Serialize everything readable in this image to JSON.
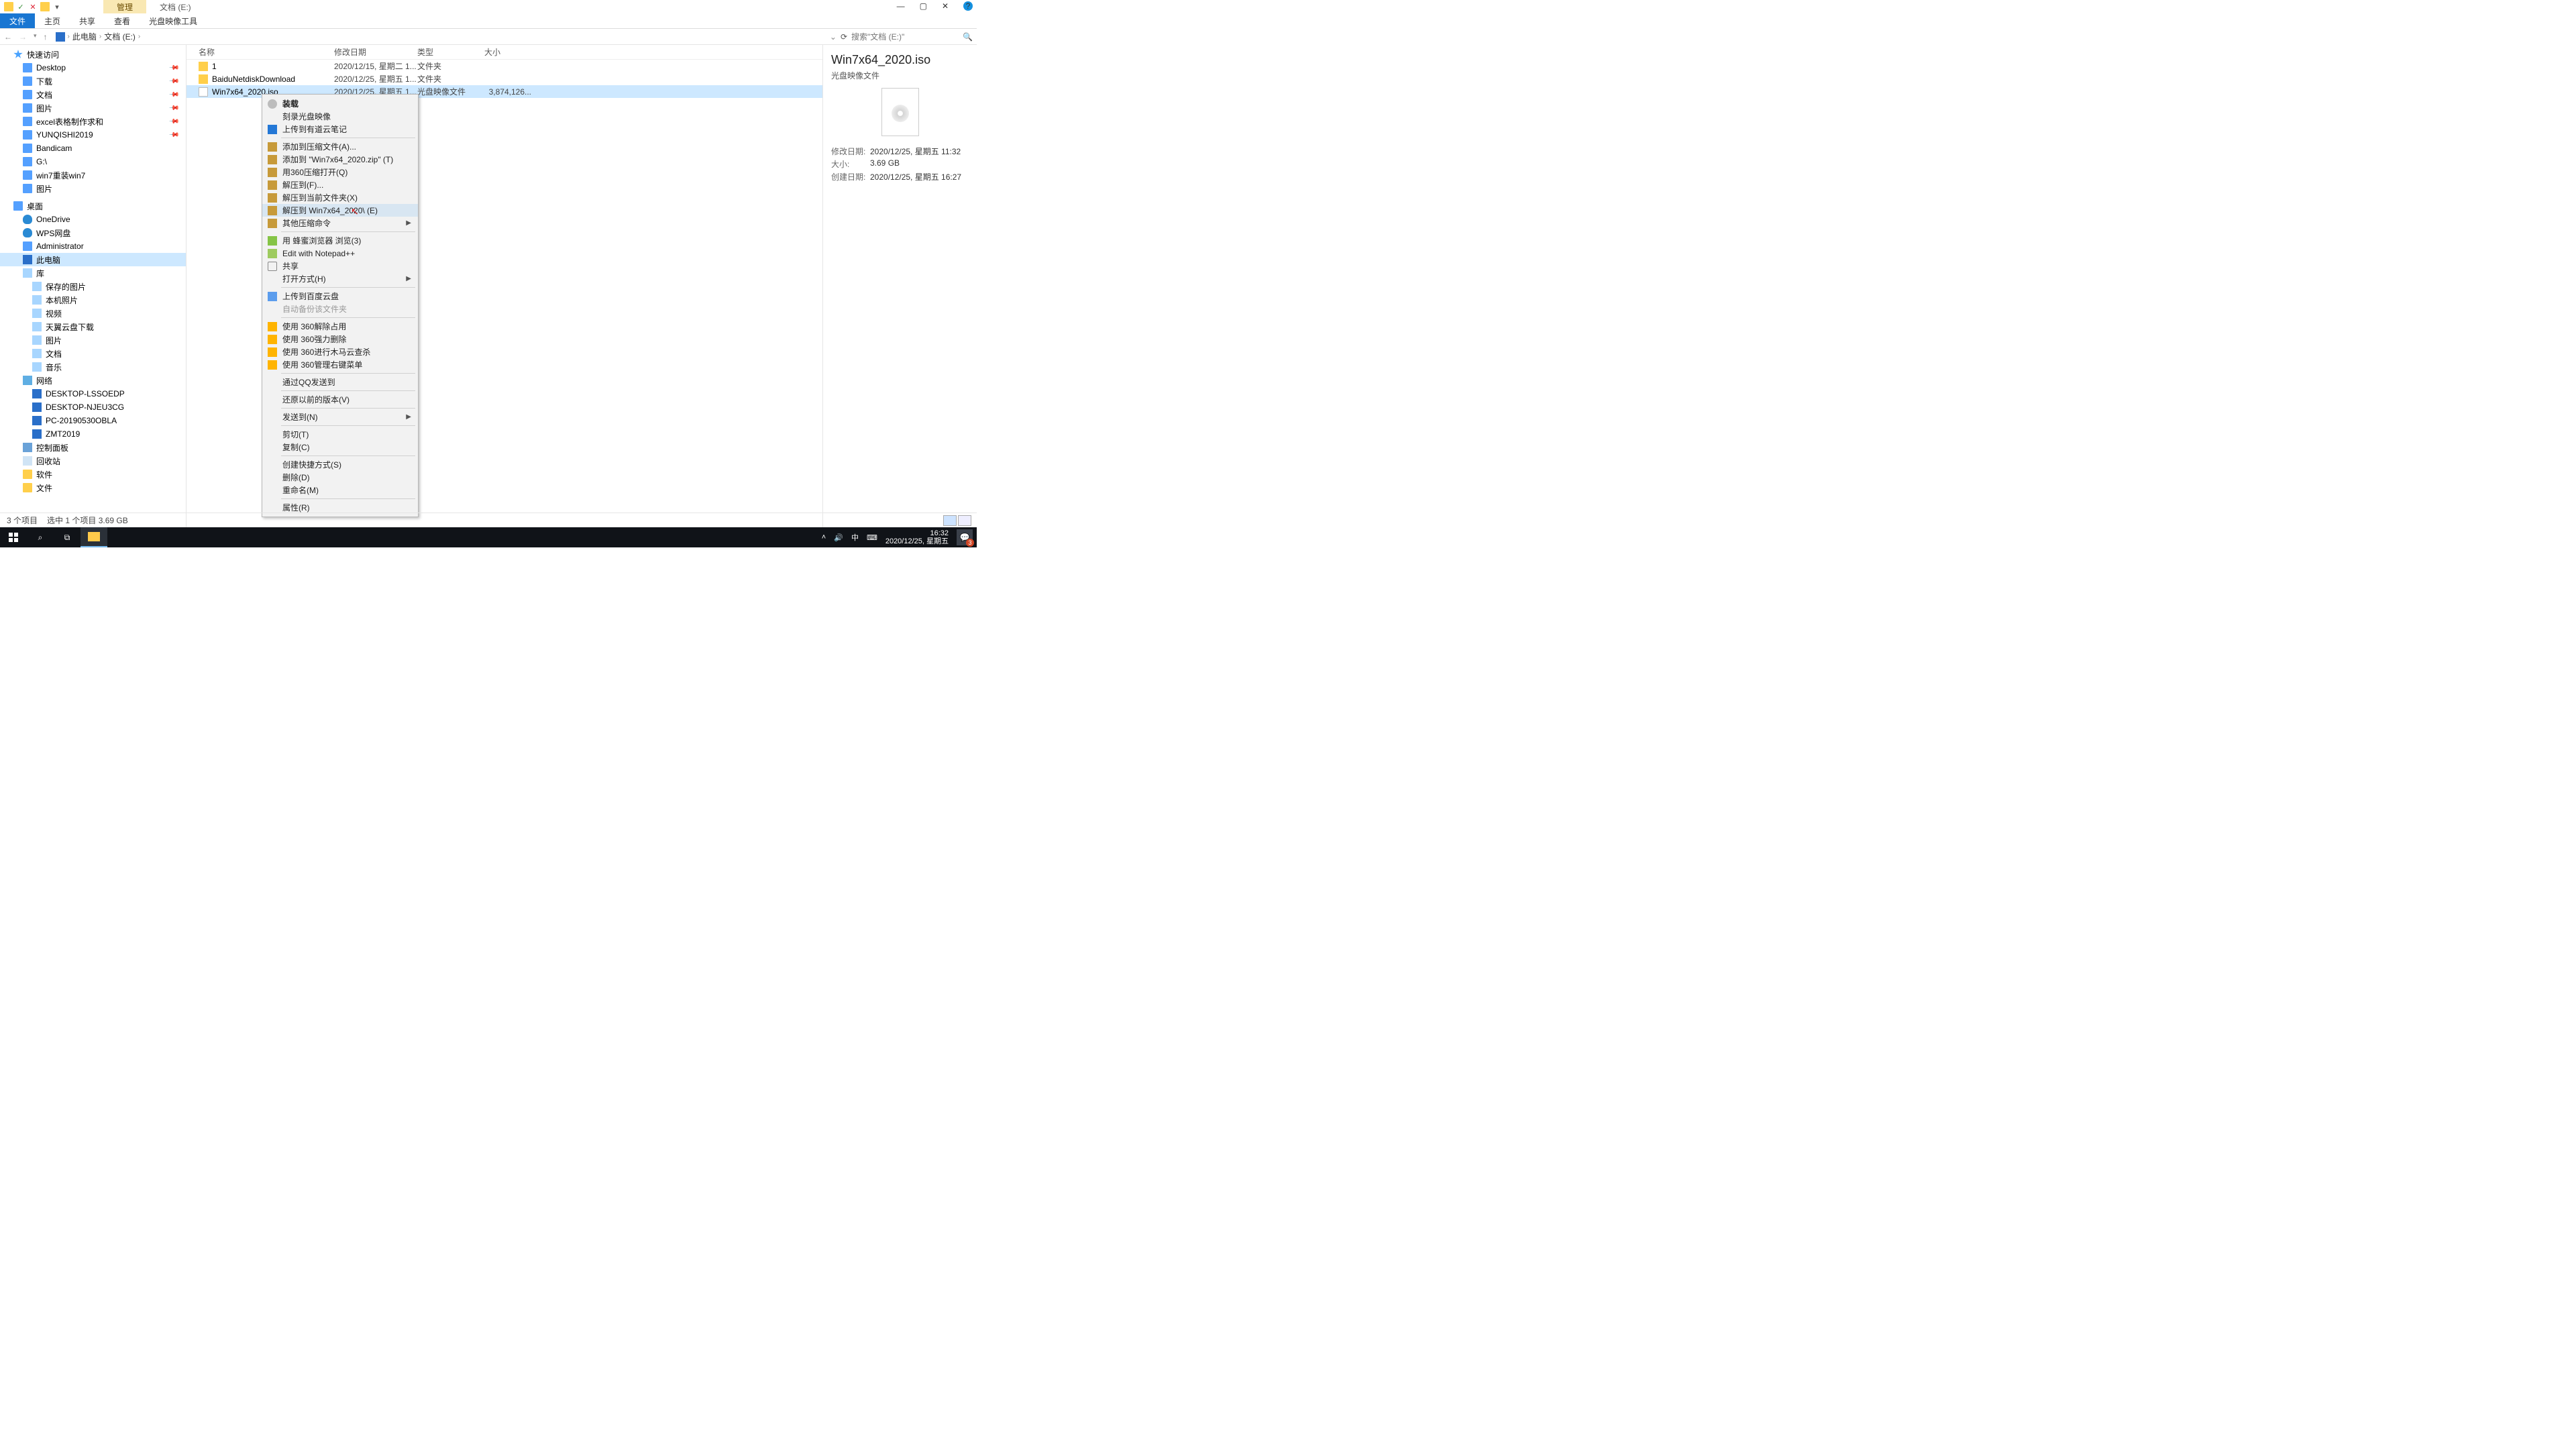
{
  "window": {
    "ribbonContext": "管理",
    "title": "文档 (E:)"
  },
  "ribbon": {
    "file": "文件",
    "home": "主页",
    "share": "共享",
    "view": "查看",
    "disc": "光盘映像工具"
  },
  "addr": {
    "thispc": "此电脑",
    "loc": "文档 (E:)",
    "search_ph": "搜索\"文档 (E:)\""
  },
  "nav": {
    "quick": "快速访问",
    "items1": [
      "Desktop",
      "下载",
      "文档",
      "图片",
      "excel表格制作求和",
      "YUNQISHI2019",
      "Bandicam",
      "G:\\",
      "win7重装win7",
      "图片"
    ],
    "desktop": "桌面",
    "items2": [
      "OneDrive",
      "WPS网盘",
      "Administrator"
    ],
    "thispc": "此电脑",
    "lib": "库",
    "libItems": [
      "保存的图片",
      "本机照片",
      "视频",
      "天翼云盘下载",
      "图片",
      "文档",
      "音乐"
    ],
    "net": "网络",
    "netItems": [
      "DESKTOP-LSSOEDP",
      "DESKTOP-NJEU3CG",
      "PC-20190530OBLA",
      "ZMT2019"
    ],
    "cp": "控制面板",
    "rb": "回收站",
    "sw": "软件",
    "fl": "文件"
  },
  "cols": {
    "name": "名称",
    "date": "修改日期",
    "type": "类型",
    "size": "大小"
  },
  "rows": [
    {
      "name": "1",
      "date": "2020/12/15, 星期二 1...",
      "type": "文件夹",
      "size": ""
    },
    {
      "name": "BaiduNetdiskDownload",
      "date": "2020/12/25, 星期五 1...",
      "type": "文件夹",
      "size": ""
    },
    {
      "name": "Win7x64_2020.iso",
      "date": "2020/12/25, 星期五 1...",
      "type": "光盘映像文件",
      "size": "3,874,126..."
    }
  ],
  "ctx": [
    {
      "t": "装载",
      "ico": "ci-cd",
      "bold": true
    },
    {
      "t": "刻录光盘映像"
    },
    {
      "t": "上传到有道云笔记",
      "ico": "ci-up"
    },
    {
      "sep": true
    },
    {
      "t": "添加到压缩文件(A)...",
      "ico": "ci-zip"
    },
    {
      "t": "添加到 \"Win7x64_2020.zip\" (T)",
      "ico": "ci-zip"
    },
    {
      "t": "用360压缩打开(Q)",
      "ico": "ci-zip"
    },
    {
      "t": "解压到(F)...",
      "ico": "ci-zip"
    },
    {
      "t": "解压到当前文件夹(X)",
      "ico": "ci-zip"
    },
    {
      "t": "解压到 Win7x64_2020\\ (E)",
      "ico": "ci-zip",
      "hl": true
    },
    {
      "t": "其他压缩命令",
      "ico": "ci-zip",
      "arrow": true
    },
    {
      "sep": true
    },
    {
      "t": "用 蜂蜜浏览器 浏览(3)",
      "ico": "ci-bee"
    },
    {
      "t": "Edit with Notepad++",
      "ico": "ci-npp"
    },
    {
      "t": "共享",
      "ico": "ci-sh"
    },
    {
      "t": "打开方式(H)",
      "arrow": true
    },
    {
      "sep": true
    },
    {
      "t": "上传到百度云盘",
      "ico": "ci-fm"
    },
    {
      "t": "自动备份该文件夹",
      "dis": true
    },
    {
      "sep": true
    },
    {
      "t": "使用 360解除占用",
      "ico": "ci-360"
    },
    {
      "t": "使用 360强力删除",
      "ico": "ci-360"
    },
    {
      "t": "使用 360进行木马云查杀",
      "ico": "ci-360"
    },
    {
      "t": "使用 360管理右键菜单",
      "ico": "ci-360"
    },
    {
      "sep": true
    },
    {
      "t": "通过QQ发送到"
    },
    {
      "sep": true
    },
    {
      "t": "还原以前的版本(V)"
    },
    {
      "sep": true
    },
    {
      "t": "发送到(N)",
      "arrow": true
    },
    {
      "sep": true
    },
    {
      "t": "剪切(T)"
    },
    {
      "t": "复制(C)"
    },
    {
      "sep": true
    },
    {
      "t": "创建快捷方式(S)"
    },
    {
      "t": "删除(D)"
    },
    {
      "t": "重命名(M)"
    },
    {
      "sep": true
    },
    {
      "t": "属性(R)"
    }
  ],
  "details": {
    "title": "Win7x64_2020.iso",
    "sub": "光盘映像文件",
    "mod_l": "修改日期:",
    "mod_v": "2020/12/25, 星期五 11:32",
    "size_l": "大小:",
    "size_v": "3.69 GB",
    "crt_l": "创建日期:",
    "crt_v": "2020/12/25, 星期五 16:27"
  },
  "status": {
    "count": "3 个项目",
    "sel": "选中 1 个项目  3.69 GB"
  },
  "tb": {
    "ime": "中",
    "time": "16:32",
    "date": "2020/12/25, 星期五",
    "badge": "3"
  }
}
